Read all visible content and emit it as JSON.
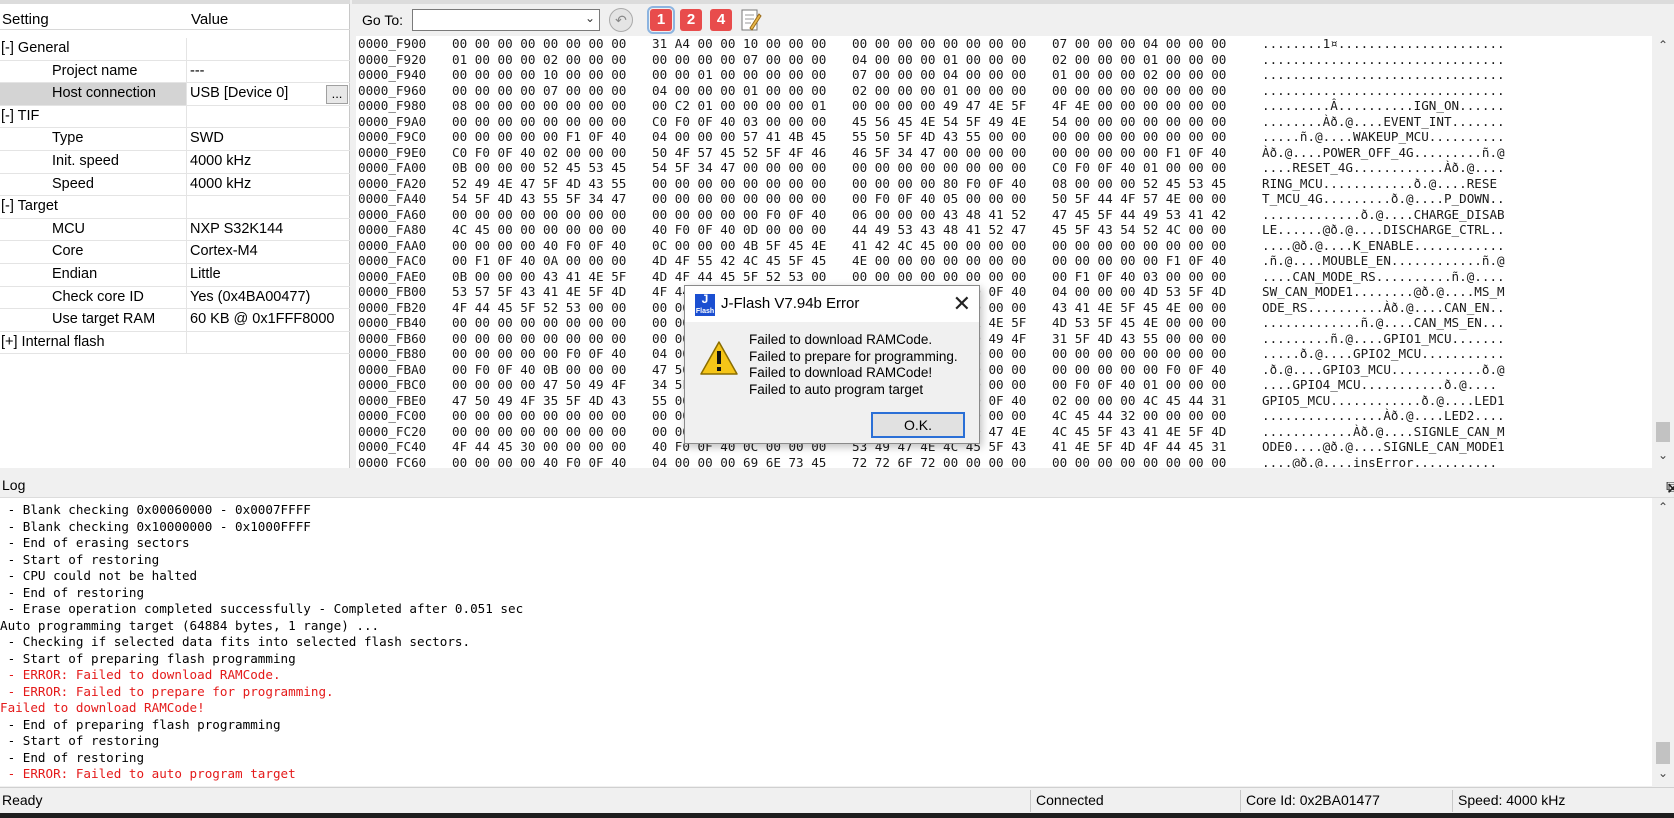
{
  "settings": {
    "col_setting": "Setting",
    "col_value": "Value",
    "rows": [
      {
        "label": "[-] General",
        "value": "",
        "indent": 0
      },
      {
        "label": "Project name",
        "value": "---",
        "indent": 1
      },
      {
        "label": "Host connection",
        "value": "USB [Device 0]",
        "indent": 1,
        "selected": true,
        "browse": "..."
      },
      {
        "label": "[-] TIF",
        "value": "",
        "indent": 0
      },
      {
        "label": "Type",
        "value": "SWD",
        "indent": 1
      },
      {
        "label": "Init. speed",
        "value": "4000 kHz",
        "indent": 1
      },
      {
        "label": "Speed",
        "value": "4000 kHz",
        "indent": 1
      },
      {
        "label": "[-] Target",
        "value": "",
        "indent": 0
      },
      {
        "label": "MCU",
        "value": "NXP S32K144",
        "indent": 1
      },
      {
        "label": "Core",
        "value": "Cortex-M4",
        "indent": 1
      },
      {
        "label": "Endian",
        "value": "Little",
        "indent": 1
      },
      {
        "label": "Check core ID",
        "value": "Yes (0x4BA00477)",
        "indent": 1
      },
      {
        "label": "Use target RAM",
        "value": "60 KB @ 0x1FFF8000",
        "indent": 1
      },
      {
        "label": "[+] Internal flash",
        "value": "",
        "indent": 0
      }
    ]
  },
  "toolbar": {
    "goto_label": "Go To:",
    "goto_value": "",
    "buttons": [
      "1",
      "2",
      "4"
    ]
  },
  "hex": {
    "rows": [
      {
        "addr": "0000_F900",
        "b1": "00 00 00 00 00 00 00 00",
        "b2": "31 A4 00 00 10 00 00 00",
        "b3": "00 00 00 00 00 00 00 00",
        "b4": "07 00 00 00 04 00 00 00",
        "ascii": "........1¤......................"
      },
      {
        "addr": "0000_F920",
        "b1": "01 00 00 00 02 00 00 00",
        "b2": "00 00 00 00 07 00 00 00",
        "b3": "04 00 00 00 01 00 00 00",
        "b4": "02 00 00 00 01 00 00 00",
        "ascii": "................................"
      },
      {
        "addr": "0000_F940",
        "b1": "00 00 00 00 10 00 00 00",
        "b2": "00 00 01 00 00 00 00 00",
        "b3": "07 00 00 00 04 00 00 00",
        "b4": "01 00 00 00 02 00 00 00",
        "ascii": "................................"
      },
      {
        "addr": "0000_F960",
        "b1": "00 00 00 00 07 00 00 00",
        "b2": "04 00 00 00 01 00 00 00",
        "b3": "02 00 00 00 01 00 00 00",
        "b4": "00 00 00 00 00 00 00 00",
        "ascii": "................................"
      },
      {
        "addr": "0000_F980",
        "b1": "08 00 00 00 00 00 00 00",
        "b2": "00 C2 01 00 00 00 00 01",
        "b3": "00 00 00 00 49 47 4E 5F",
        "b4": "4F 4E 00 00 00 00 00 00",
        "ascii": ".........Â..........IGN_ON......"
      },
      {
        "addr": "0000_F9A0",
        "b1": "00 00 00 00 00 00 00 00",
        "b2": "C0 F0 0F 40 03 00 00 00",
        "b3": "45 56 45 4E 54 5F 49 4E",
        "b4": "54 00 00 00 00 00 00 00",
        "ascii": "........Àð.@....EVENT_INT......."
      },
      {
        "addr": "0000_F9C0",
        "b1": "00 00 00 00 00 F1 0F 40",
        "b2": "04 00 00 00 57 41 4B 45",
        "b3": "55 50 5F 4D 43 55 00 00",
        "b4": "00 00 00 00 00 00 00 00",
        "ascii": ".....ñ.@....WAKEUP_MCU.........."
      },
      {
        "addr": "0000_F9E0",
        "b1": "C0 F0 0F 40 02 00 00 00",
        "b2": "50 4F 57 45 52 5F 4F 46",
        "b3": "46 5F 34 47 00 00 00 00",
        "b4": "00 00 00 00 00 F1 0F 40",
        "ascii": "Àð.@....POWER_OFF_4G.........ñ.@"
      },
      {
        "addr": "0000_FA00",
        "b1": "0B 00 00 00 52 45 53 45",
        "b2": "54 5F 34 47 00 00 00 00",
        "b3": "00 00 00 00 00 00 00 00",
        "b4": "C0 F0 0F 40 01 00 00 00",
        "ascii": "....RESET_4G............Àð.@...."
      },
      {
        "addr": "0000_FA20",
        "b1": "52 49 4E 47 5F 4D 43 55",
        "b2": "00 00 00 00 00 00 00 00",
        "b3": "00 00 00 00 80 F0 0F 40",
        "b4": "08 00 00 00 52 45 53 45",
        "ascii": "RING_MCU............ð.@....RESE"
      },
      {
        "addr": "0000_FA40",
        "b1": "54 5F 4D 43 55 5F 34 47",
        "b2": "00 00 00 00 00 00 00 00",
        "b3": "00 F0 0F 40 05 00 00 00",
        "b4": "50 5F 44 4F 57 4E 00 00",
        "ascii": "T_MCU_4G.........ð.@....P_DOWN.."
      },
      {
        "addr": "0000_FA60",
        "b1": "00 00 00 00 00 00 00 00",
        "b2": "00 00 00 00 00 F0 0F 40",
        "b3": "06 00 00 00 43 48 41 52",
        "b4": "47 45 5F 44 49 53 41 42",
        "ascii": ".............ð.@....CHARGE_DISAB"
      },
      {
        "addr": "0000_FA80",
        "b1": "4C 45 00 00 00 00 00 00",
        "b2": "40 F0 0F 40 0D 00 00 00",
        "b3": "44 49 53 43 48 41 52 47",
        "b4": "45 5F 43 54 52 4C 00 00",
        "ascii": "LE......@ð.@....DISCHARGE_CTRL.."
      },
      {
        "addr": "0000_FAA0",
        "b1": "00 00 00 00 40 F0 0F 40",
        "b2": "0C 00 00 00 4B 5F 45 4E",
        "b3": "41 42 4C 45 00 00 00 00",
        "b4": "00 00 00 00 00 00 00 00",
        "ascii": "....@ð.@....K_ENABLE............"
      },
      {
        "addr": "0000_FAC0",
        "b1": "00 F1 0F 40 0A 00 00 00",
        "b2": "4D 4F 55 42 4C 45 5F 45",
        "b3": "4E 00 00 00 00 00 00 00",
        "b4": "00 00 00 00 00 F1 0F 40",
        "ascii": ".ñ.@....MOUBLE_EN............ñ.@"
      },
      {
        "addr": "0000_FAE0",
        "b1": "0B 00 00 00 43 41 4E 5F",
        "b2": "4D 4F 44 45 5F 52 53 00",
        "b3": "00 00 00 00 00 00 00 00",
        "b4": "00 F1 0F 40 03 00 00 00",
        "ascii": "....CAN_MODE_RS..........ñ.@...."
      },
      {
        "addr": "0000_FB00",
        "b1": "53 57 5F 43 41 4E 5F 4D",
        "b2": "4F 44 45 31 00 00 00 00",
        "b3": "00 00 00 00 40 F0 0F 40",
        "b4": "04 00 00 00 4D 53 5F 4D",
        "ascii": "SW_CAN_MODE1........@ð.@....MS_M"
      },
      {
        "addr": "0000_FB20",
        "b1": "4F 44 45 5F 52 53 00 00",
        "b2": "00 00 00 00 00 00 00 00",
        "b3": "C0 F0 0F 40 04 00 00 00",
        "b4": "43 41 4E 5F 45 4E 00 00",
        "ascii": "ODE_RS..........Àð.@....CAN_EN.."
      },
      {
        "addr": "0000_FB40",
        "b1": "00 00 00 00 00 00 00 00",
        "b2": "00 00 00 00 00 F1 0F 40",
        "b3": "04 00 00 00 43 41 4E 5F",
        "b4": "4D 53 5F 45 4E 00 00 00",
        "ascii": ".............ñ.@....CAN_MS_EN..."
      },
      {
        "addr": "0000_FB60",
        "b1": "00 00 00 00 00 00 00 00",
        "b2": "00 00 00 00 00 F1 0F 40",
        "b3": "04 00 00 00 47 50 49 4F",
        "b4": "31 5F 4D 43 55 00 00 00",
        "ascii": ".........ñ.@....GPIO1_MCU......."
      },
      {
        "addr": "0000_FB80",
        "b1": "00 00 00 00 00 F0 0F 40",
        "b2": "04 00 00 00 47 50 49 4F",
        "b3": "32 5F 4D 43 55 00 00 00",
        "b4": "00 00 00 00 00 00 00 00",
        "ascii": ".....ð.@....GPIO2_MCU..........."
      },
      {
        "addr": "0000_FBA0",
        "b1": "00 F0 0F 40 0B 00 00 00",
        "b2": "47 50 49 4F 33 5F 4D 43",
        "b3": "55 00 00 00 00 00 00 00",
        "b4": "00 00 00 00 00 F0 0F 40",
        "ascii": ".ð.@....GPIO3_MCU............ð.@"
      },
      {
        "addr": "0000_FBC0",
        "b1": "00 00 00 00 47 50 49 4F",
        "b2": "34 5F 4D 43 55 00 00 00",
        "b3": "00 00 00 00 00 00 00 00",
        "b4": "00 F0 0F 40 01 00 00 00",
        "ascii": "....GPIO4_MCU...........ð.@...."
      },
      {
        "addr": "0000_FBE0",
        "b1": "47 50 49 4F 35 5F 4D 43",
        "b2": "55 00 00 00 00 00 00 00",
        "b3": "00 00 00 00 00 F0 0F 40",
        "b4": "02 00 00 00 4C 45 44 31",
        "ascii": "GPIO5_MCU............ð.@....LED1"
      },
      {
        "addr": "0000_FC00",
        "b1": "00 00 00 00 00 00 00 00",
        "b2": "00 00 00 00 00 00 00 00",
        "b3": "C0 F0 0F 40 00 00 00 00",
        "b4": "4C 45 44 32 00 00 00 00",
        "ascii": "................Àð.@....LED2...."
      },
      {
        "addr": "0000_FC20",
        "b1": "00 00 00 00 00 00 00 00",
        "b2": "00 00 00 00 C0 F0 0F 40",
        "b3": "0B 00 00 00 53 49 47 4E",
        "b4": "4C 45 5F 43 41 4E 5F 4D",
        "ascii": "............Àð.@....SIGNLE_CAN_M"
      },
      {
        "addr": "0000_FC40",
        "b1": "4F 44 45 30 00 00 00 00",
        "b2": "40 F0 0F 40 0C 00 00 00",
        "b3": "53 49 47 4E 4C 45 5F 43",
        "b4": "41 4E 5F 4D 4F 44 45 31",
        "ascii": "ODE0....@ð.@....SIGNLE_CAN_MODE1"
      },
      {
        "addr": "0000_FC60",
        "b1": "00 00 00 00 40 F0 0F 40",
        "b2": "04 00 00 00 69 6E 73 45",
        "b3": "72 72 6F 72 00 00 00 00",
        "b4": "00 00 00 00 00 00 00 00",
        "ascii": "....@ð.@....insError..........."
      }
    ]
  },
  "log": {
    "title": "Log",
    "lines": [
      {
        "text": " - Blank checking 0x00060000 - 0x0007FFFF",
        "error": false
      },
      {
        "text": " - Blank checking 0x10000000 - 0x1000FFFF",
        "error": false
      },
      {
        "text": " - End of erasing sectors",
        "error": false
      },
      {
        "text": " - Start of restoring",
        "error": false
      },
      {
        "text": " - CPU could not be halted",
        "error": false
      },
      {
        "text": " - End of restoring",
        "error": false
      },
      {
        "text": " - Erase operation completed successfully - Completed after 0.051 sec",
        "error": false
      },
      {
        "text": "Auto programming target (64884 bytes, 1 range) ...",
        "error": false
      },
      {
        "text": " - Checking if selected data fits into selected flash sectors.",
        "error": false
      },
      {
        "text": " - Start of preparing flash programming",
        "error": false
      },
      {
        "text": " - ERROR: Failed to download RAMCode.",
        "error": true
      },
      {
        "text": " - ERROR: Failed to prepare for programming.",
        "error": true
      },
      {
        "text": "Failed to download RAMCode!",
        "error": true
      },
      {
        "text": " - End of preparing flash programming",
        "error": false
      },
      {
        "text": " - Start of restoring",
        "error": false
      },
      {
        "text": " - End of restoring",
        "error": false
      },
      {
        "text": " - ERROR: Failed to auto program target",
        "error": true
      }
    ]
  },
  "status": {
    "state": "Ready",
    "connection": "Connected",
    "core_id": "Core Id: 0x2BA01477",
    "speed": "Speed: 4000 kHz"
  },
  "dialog": {
    "icon_text": "J",
    "icon_sub": "Flash",
    "title": "J-Flash V7.94b Error",
    "messages": [
      "Failed to download RAMCode.",
      "Failed to prepare for programming.",
      "Failed to download RAMCode!",
      "Failed to auto program target"
    ],
    "ok_label": "O.K."
  },
  "colors": {
    "error_text": "#e41a1a",
    "toolbar_badge": "#e84c4c",
    "focus_border": "#2a6fd6"
  }
}
